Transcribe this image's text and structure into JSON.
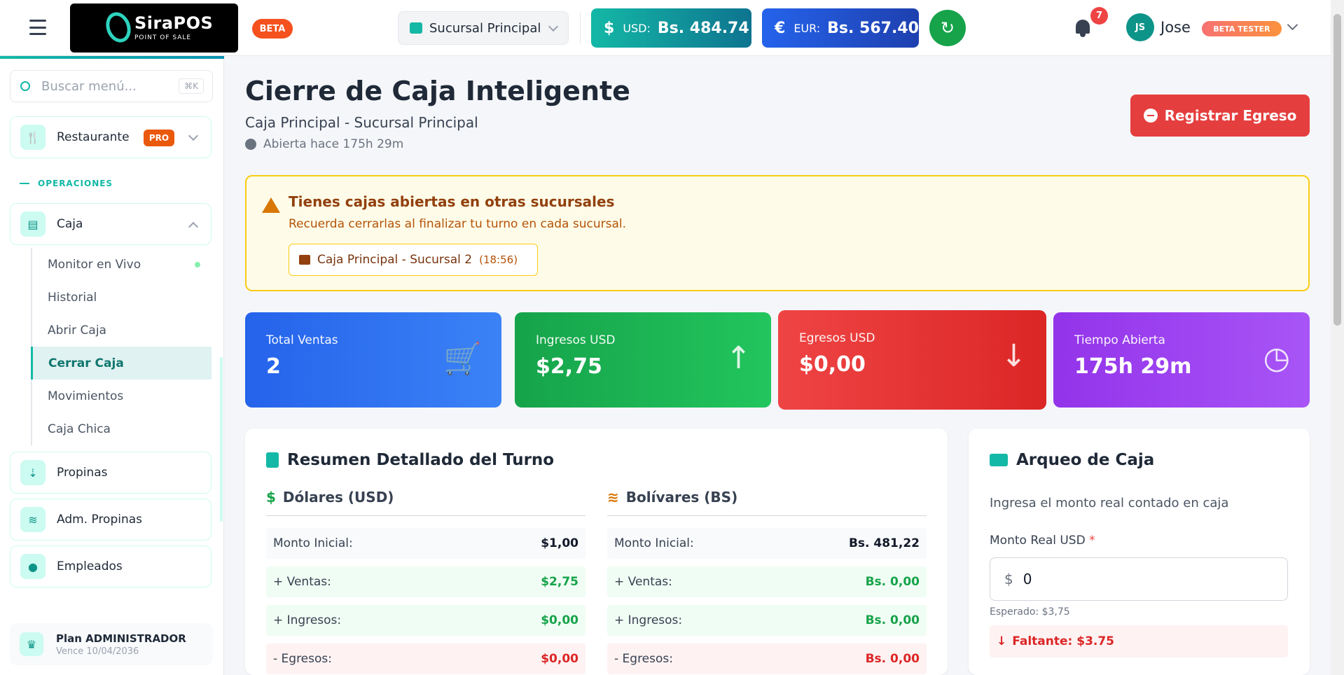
{
  "header": {
    "logo_name": "SiraPOS",
    "logo_sub": "POINT OF SALE",
    "beta": "BETA",
    "branch": "Sucursal Principal",
    "usd_symbol": "$",
    "usd_label": "USD:",
    "usd_value": "Bs. 484.74",
    "eur_symbol": "€",
    "eur_label": "EUR:",
    "eur_value": "Bs. 567.40",
    "refresh_icon": "↻",
    "notifications": "7",
    "avatar": "JS",
    "user_name": "Jose",
    "user_badge": "BETA TESTER"
  },
  "sidebar": {
    "search_placeholder": "Buscar menú...",
    "search_kbd": "⌘K",
    "restaurante": {
      "label": "Restaurante",
      "badge": "PRO",
      "icon": "🍴"
    },
    "section_operaciones": "OPERACIONES",
    "caja": {
      "label": "Caja",
      "icon": "▤"
    },
    "caja_items": [
      {
        "label": "Monitor en Vivo"
      },
      {
        "label": "Historial"
      },
      {
        "label": "Abrir Caja"
      },
      {
        "label": "Cerrar Caja"
      },
      {
        "label": "Movimientos"
      },
      {
        "label": "Caja Chica"
      }
    ],
    "propinas": {
      "label": "Propinas",
      "icon": "⇣"
    },
    "adm_propinas": {
      "label": "Adm. Propinas",
      "icon": "≋"
    },
    "empleados": {
      "label": "Empleados",
      "icon": "●"
    },
    "plan_title": "Plan ADMINISTRADOR",
    "plan_expiry": "Vence 10/04/2036",
    "plan_icon": "♛"
  },
  "page": {
    "title": "Cierre de Caja Inteligente",
    "subtitle": "Caja Principal - Sucursal Principal",
    "opened": "Abierta hace 175h 29m",
    "btn_egreso": "Registrar Egreso"
  },
  "alert": {
    "title": "Tienes cajas abiertas en otras sucursales",
    "text": "Recuerda cerrarlas al finalizar tu turno en cada sucursal.",
    "chip_label": "Caja Principal - Sucursal 2",
    "chip_time": "(18:56)"
  },
  "stats": [
    {
      "label": "Total Ventas",
      "value": "2",
      "icon": "🛒"
    },
    {
      "label": "Ingresos USD",
      "value": "$2,75",
      "icon": "↑"
    },
    {
      "label": "Egresos USD",
      "value": "$0,00",
      "icon": "↓"
    },
    {
      "label": "Tiempo Abierta",
      "value": "175h 29m",
      "icon": "◷"
    }
  ],
  "resumen": {
    "title": "Resumen Detallado del Turno",
    "usd_title": "Dólares (USD)",
    "usd_symbol": "$",
    "bs_title": "Bolívares (BS)",
    "bs_symbol": "≋",
    "usd_rows": [
      {
        "k": "Monto Inicial:",
        "v": "$1,00"
      },
      {
        "k": "+ Ventas:",
        "v": "$2,75"
      },
      {
        "k": "+ Ingresos:",
        "v": "$0,00"
      },
      {
        "k": "- Egresos:",
        "v": "$0,00"
      }
    ],
    "bs_rows": [
      {
        "k": "Monto Inicial:",
        "v": "Bs. 481,22"
      },
      {
        "k": "+ Ventas:",
        "v": "Bs. 0,00"
      },
      {
        "k": "+ Ingresos:",
        "v": "Bs. 0,00"
      },
      {
        "k": "- Egresos:",
        "v": "Bs. 0,00"
      }
    ]
  },
  "arqueo": {
    "title": "Arqueo de Caja",
    "hint": "Ingresa el monto real contado en caja",
    "label": "Monto Real USD",
    "required": "*",
    "currency": "$",
    "value": "0",
    "expected": "Esperado: $3,75",
    "faltante": "Faltante: $3.75",
    "faltante_icon": "↓"
  }
}
